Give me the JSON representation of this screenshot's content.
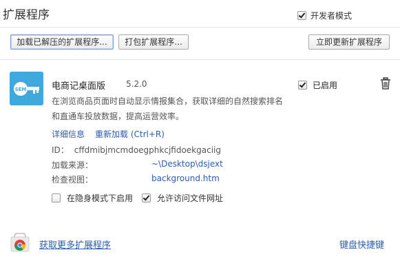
{
  "header": {
    "title": "扩展程序",
    "dev_mode_label": "开发者模式",
    "dev_mode_checked": true
  },
  "toolbar": {
    "load_unpacked_label": "加载已解压的扩展程序...",
    "pack_label": "打包扩展程序...",
    "update_label": "立即更新扩展程序"
  },
  "extension": {
    "icon_text": "SEM",
    "name": "电商记桌面版",
    "version": "5.2.0",
    "description": "在浏览商品页面时自动显示情报集合，获取详细的自然搜索排名和直通车投放数据，提高运营效率。",
    "details_link": "详细信息",
    "reload_link": "重新加载 (Ctrl+R)",
    "id_label": "ID：",
    "id_value": "cffdmibjmcmdoegphkcjfidoekgaciig",
    "source_label": "加载来源：",
    "source_value": "~\\Desktop\\dsjext",
    "inspect_label": "检查视图：",
    "inspect_value": "background.htm",
    "incognito_label": "在隐身模式下启用",
    "incognito_checked": false,
    "file_url_label": "允许访问文件网址",
    "file_url_checked": true,
    "enabled_label": "已启用",
    "enabled_checked": true,
    "icon_color": "#3fa8dc"
  },
  "footer": {
    "gallery_link": "获取更多扩展程序",
    "shortcuts_link": "键盘快捷键"
  },
  "colors": {
    "link": "#2a5db0",
    "accent_border": "#7d9bd1"
  }
}
